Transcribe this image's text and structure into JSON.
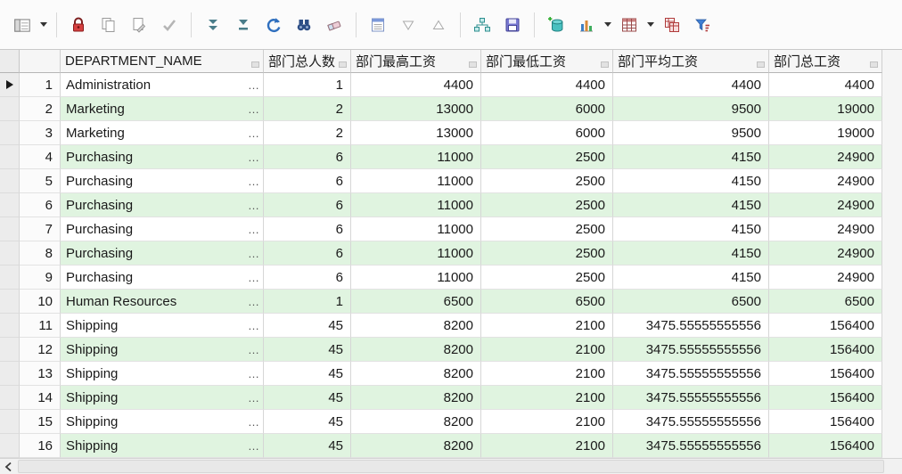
{
  "toolbar": {
    "icons": [
      "record-view-icon",
      "dropdown-caret",
      "lock-icon",
      "copy-record-icon",
      "edit-record-icon",
      "post-changes-check-icon",
      "fetch-next-icon",
      "fetch-all-icon",
      "refresh-icon",
      "find-icon",
      "eraser-icon",
      "copy-special-icon",
      "sort-desc-icon",
      "sort-asc-icon",
      "master-detail-icon",
      "save-icon",
      "database-add-icon",
      "chart-icon",
      "pivot-grid-icon",
      "copy-table-icon",
      "filter-icon",
      "scroll-left-chevron-icon"
    ]
  },
  "table": {
    "columns": [
      {
        "label": "DEPARTMENT_NAME"
      },
      {
        "label": "部门总人数"
      },
      {
        "label": "部门最高工资"
      },
      {
        "label": "部门最低工资"
      },
      {
        "label": "部门平均工资"
      },
      {
        "label": "部门总工资"
      }
    ],
    "rows": [
      {
        "n": 1,
        "department": "Administration",
        "count": "1",
        "max": "4400",
        "min": "4400",
        "avg": "4400",
        "total": "4400",
        "current": true
      },
      {
        "n": 2,
        "department": "Marketing",
        "count": "2",
        "max": "13000",
        "min": "6000",
        "avg": "9500",
        "total": "19000"
      },
      {
        "n": 3,
        "department": "Marketing",
        "count": "2",
        "max": "13000",
        "min": "6000",
        "avg": "9500",
        "total": "19000"
      },
      {
        "n": 4,
        "department": "Purchasing",
        "count": "6",
        "max": "11000",
        "min": "2500",
        "avg": "4150",
        "total": "24900"
      },
      {
        "n": 5,
        "department": "Purchasing",
        "count": "6",
        "max": "11000",
        "min": "2500",
        "avg": "4150",
        "total": "24900"
      },
      {
        "n": 6,
        "department": "Purchasing",
        "count": "6",
        "max": "11000",
        "min": "2500",
        "avg": "4150",
        "total": "24900"
      },
      {
        "n": 7,
        "department": "Purchasing",
        "count": "6",
        "max": "11000",
        "min": "2500",
        "avg": "4150",
        "total": "24900"
      },
      {
        "n": 8,
        "department": "Purchasing",
        "count": "6",
        "max": "11000",
        "min": "2500",
        "avg": "4150",
        "total": "24900"
      },
      {
        "n": 9,
        "department": "Purchasing",
        "count": "6",
        "max": "11000",
        "min": "2500",
        "avg": "4150",
        "total": "24900"
      },
      {
        "n": 10,
        "department": "Human Resources",
        "count": "1",
        "max": "6500",
        "min": "6500",
        "avg": "6500",
        "total": "6500"
      },
      {
        "n": 11,
        "department": "Shipping",
        "count": "45",
        "max": "8200",
        "min": "2100",
        "avg": "3475.55555555556",
        "total": "156400"
      },
      {
        "n": 12,
        "department": "Shipping",
        "count": "45",
        "max": "8200",
        "min": "2100",
        "avg": "3475.55555555556",
        "total": "156400"
      },
      {
        "n": 13,
        "department": "Shipping",
        "count": "45",
        "max": "8200",
        "min": "2100",
        "avg": "3475.55555555556",
        "total": "156400"
      },
      {
        "n": 14,
        "department": "Shipping",
        "count": "45",
        "max": "8200",
        "min": "2100",
        "avg": "3475.55555555556",
        "total": "156400"
      },
      {
        "n": 15,
        "department": "Shipping",
        "count": "45",
        "max": "8200",
        "min": "2100",
        "avg": "3475.55555555556",
        "total": "156400"
      },
      {
        "n": 16,
        "department": "Shipping",
        "count": "45",
        "max": "8200",
        "min": "2100",
        "avg": "3475.55555555556",
        "total": "156400"
      }
    ]
  },
  "colors": {
    "stripe": "#e0f4e0",
    "header_bg": "#f6f6f6",
    "toolbar_bg": "#fbfbfb",
    "lock_red": "#d64040",
    "accent_blue": "#2f6fbe"
  }
}
